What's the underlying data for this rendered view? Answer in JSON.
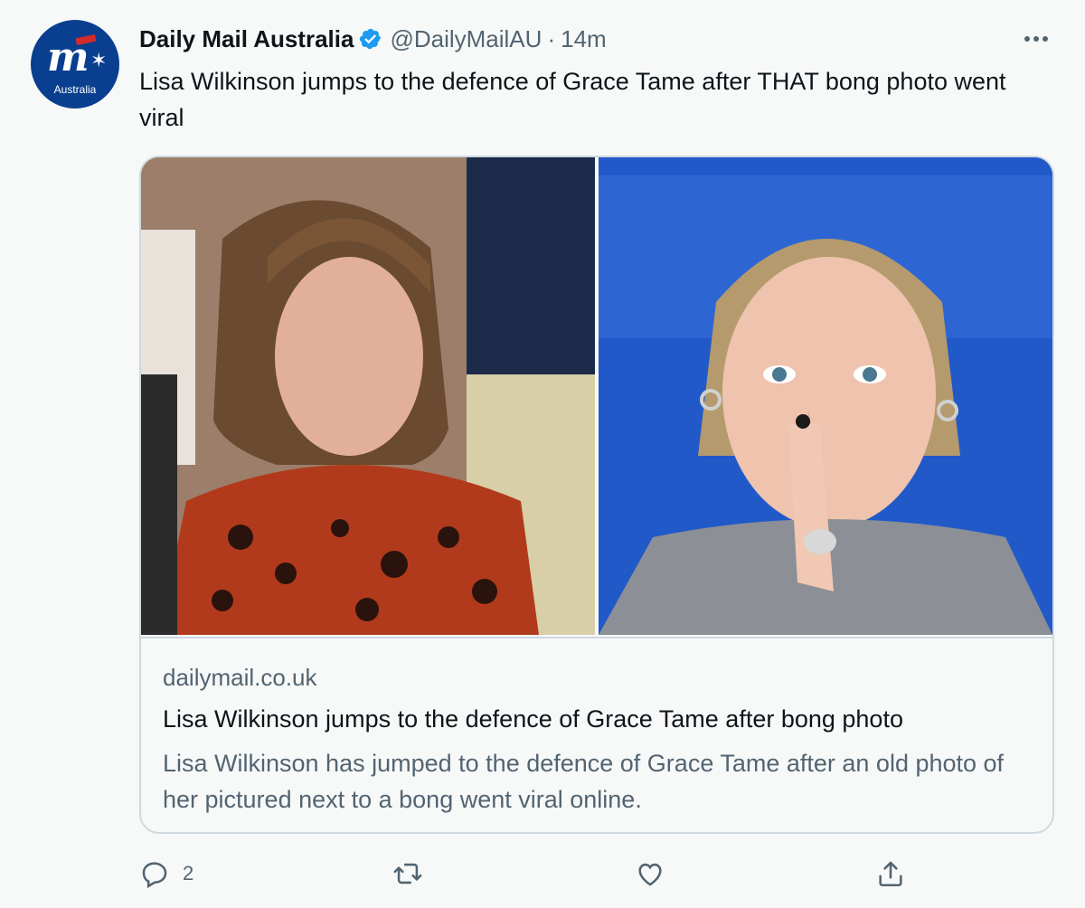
{
  "author": {
    "display_name": "Daily Mail Australia",
    "handle": "@DailyMailAU",
    "separator": "·",
    "time": "14m",
    "avatar_text": "Australia"
  },
  "tweet": {
    "text": "Lisa Wilkinson jumps to the defence of Grace Tame after THAT bong photo went viral"
  },
  "card": {
    "domain": "dailymail.co.uk",
    "title": "Lisa Wilkinson jumps to the defence of Grace Tame after bong photo",
    "description": "Lisa Wilkinson has jumped to the defence of Grace Tame after an old photo of her pictured next to a bong went viral online."
  },
  "actions": {
    "reply_count": "2"
  },
  "colors": {
    "verified": "#1d9bf0",
    "text_secondary": "#536471",
    "border": "#cfd9de",
    "background": "#f7f9f9"
  },
  "icons": [
    "verified-badge-icon",
    "more-icon",
    "reply-icon",
    "retweet-icon",
    "like-icon",
    "share-icon"
  ]
}
